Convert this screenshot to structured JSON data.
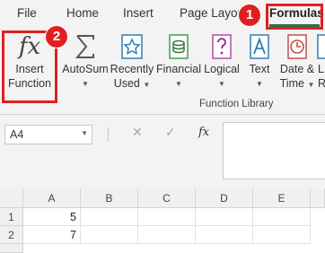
{
  "tabs": [
    "File",
    "Home",
    "Insert",
    "Page Layout",
    "Formulas"
  ],
  "active_tab": "Formulas",
  "ribbon": {
    "commands": [
      {
        "label1": "Insert",
        "label2": "Function",
        "icon": "fx-icon",
        "dropdown": false
      },
      {
        "label1": "AutoSum",
        "label2": "",
        "icon": "sigma-icon",
        "dropdown": true
      },
      {
        "label1": "Recently",
        "label2": "Used",
        "icon": "star-icon",
        "dropdown": true
      },
      {
        "label1": "Financial",
        "label2": "",
        "icon": "coins-icon",
        "dropdown": true
      },
      {
        "label1": "Logical",
        "label2": "",
        "icon": "question-icon",
        "dropdown": true
      },
      {
        "label1": "Text",
        "label2": "",
        "icon": "text-a-icon",
        "dropdown": true
      },
      {
        "label1": "Date &",
        "label2": "Time",
        "icon": "clock-icon",
        "dropdown": true
      },
      {
        "label1": "L",
        "label2": "R",
        "icon": "lookup-icon",
        "dropdown": false
      }
    ],
    "insert_function_icon_text": "fx",
    "group_label": "Function Library"
  },
  "callouts": [
    "1",
    "2"
  ],
  "formula_bar": {
    "name_box": "A4",
    "cancel_symbol": "✕",
    "enter_symbol": "✓",
    "fx_symbol": "fx",
    "formula": ""
  },
  "grid": {
    "columns": [
      "A",
      "B",
      "C",
      "D",
      "E"
    ],
    "rows": [
      {
        "num": "1",
        "cells": [
          "5",
          "",
          "",
          "",
          ""
        ]
      },
      {
        "num": "2",
        "cells": [
          "7",
          "",
          "",
          "",
          ""
        ]
      }
    ]
  },
  "colors": {
    "accent": "#217346",
    "highlight": "#e02020"
  }
}
